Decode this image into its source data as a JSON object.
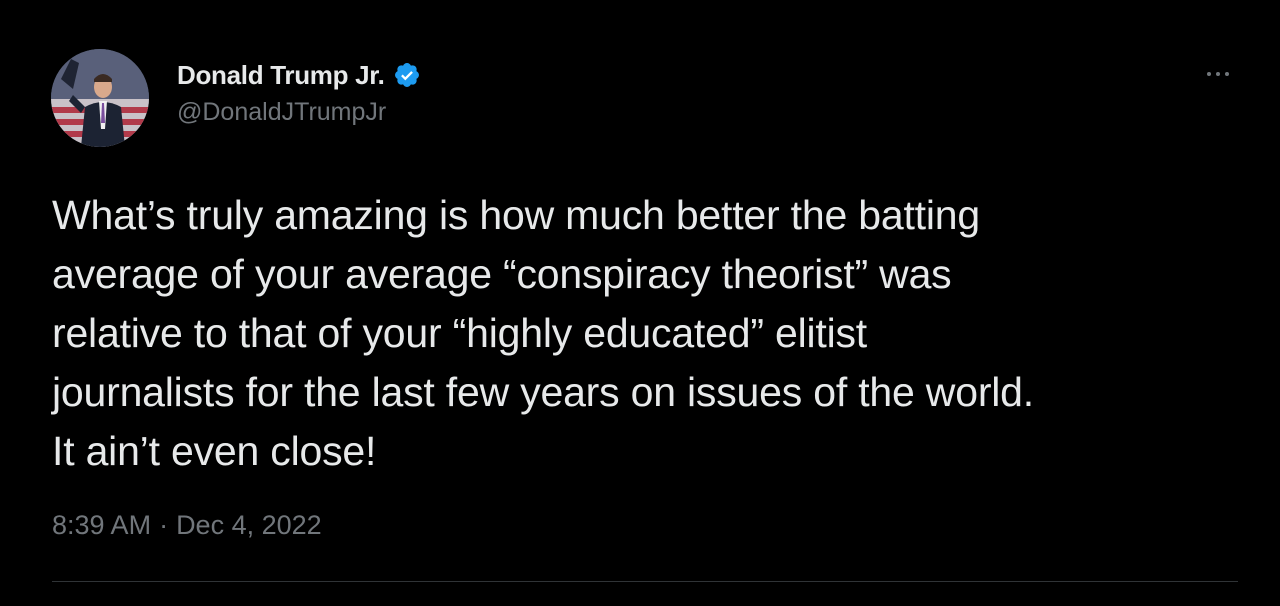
{
  "author": {
    "display_name": "Donald Trump Jr.",
    "handle": "@DonaldJTrumpJr",
    "verified_icon": "verified-badge-icon"
  },
  "tweet": {
    "text_lines": [
      "What’s truly amazing is how much better the batting",
      "average of your average “conspiracy theorist” was",
      "relative to that of your “highly educated” elitist",
      "journalists for the last few years on issues of the world.",
      "It ain’t even close!"
    ],
    "time": "8:39 AM",
    "separator": "·",
    "date": "Dec 4, 2022"
  },
  "actions": {
    "more_icon": "more-horizontal-icon"
  },
  "colors": {
    "background": "#000000",
    "primary_text": "#e7e9ea",
    "secondary_text": "#71767b",
    "verified": "#1d9bf0",
    "divider": "#2f3336"
  }
}
